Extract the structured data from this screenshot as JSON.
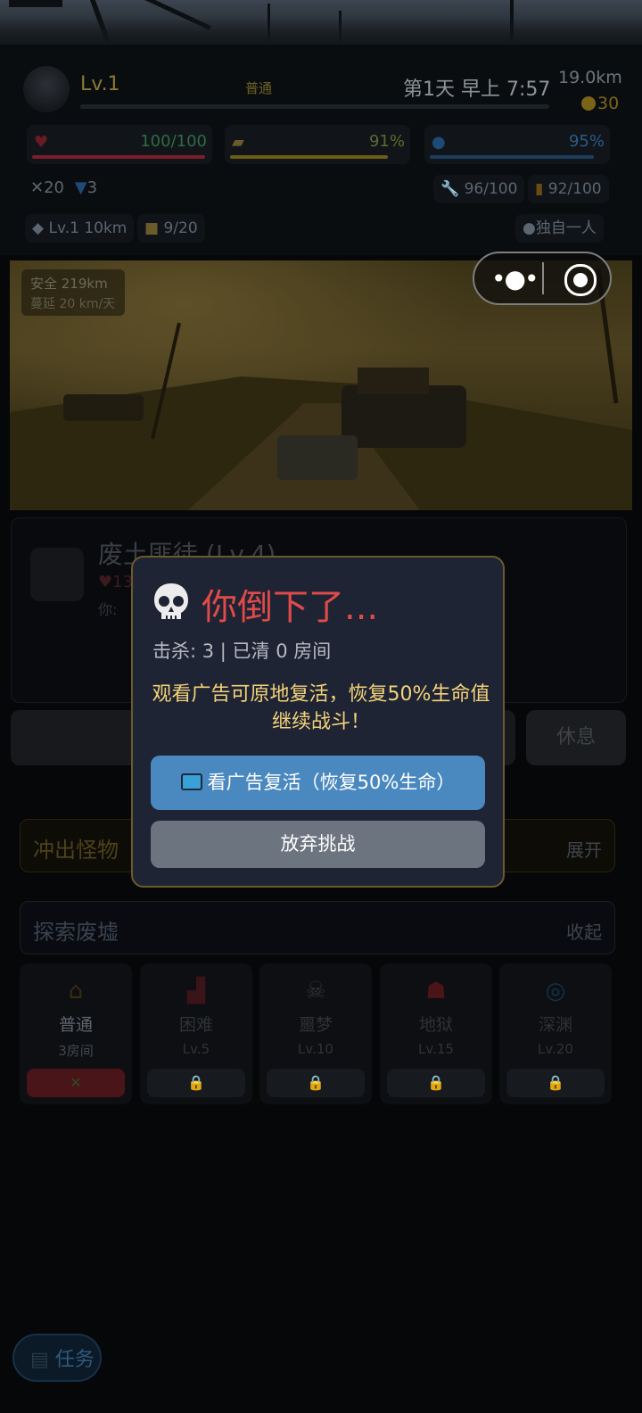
{
  "header": {
    "level": "Lv.1",
    "mode": "普通",
    "day_time": "第1天 早上 7:57",
    "distance": "19.0km",
    "coins": "30",
    "hp": "100/100",
    "food": "91%",
    "water": "95%",
    "attack": "20",
    "defense": "3",
    "tool": "96/100",
    "fuel": "92/100",
    "vehicle": "Lv.1 10km",
    "cargo": "9/20",
    "companion": "独自一人",
    "hp_fraction": 1.0,
    "food_fraction": 0.91,
    "water_fraction": 0.95
  },
  "scene": {
    "safe_distance": "安全 219km",
    "speed": "蔓延 20 km/天"
  },
  "enemy": {
    "name": "废土匪徒 (Lv.4)",
    "hp_partial": "13",
    "you_partial": "你:"
  },
  "actions": {
    "rest": "休息"
  },
  "sections": {
    "monster_title": "冲出怪物",
    "monster_toggle": "展开",
    "ruins_title": "探索废墟",
    "ruins_toggle": "收起"
  },
  "difficulties": [
    {
      "name": "普通",
      "sub": "3房间",
      "icon": "house-icon",
      "button": "✕"
    },
    {
      "name": "困难",
      "sub": "Lv.5",
      "icon": "building-icon",
      "button": "🔒"
    },
    {
      "name": "噩梦",
      "sub": "Lv.10",
      "icon": "skull-icon",
      "button": "🔒"
    },
    {
      "name": "地狱",
      "sub": "Lv.15",
      "icon": "demon-icon",
      "button": "🔒"
    },
    {
      "name": "深渊",
      "sub": "Lv.20",
      "icon": "vortex-icon",
      "button": "🔒"
    }
  ],
  "task_button": "任务",
  "modal": {
    "title": "你倒下了...",
    "kills_line": "击杀: 3 | 已清 0 房间",
    "description": "观看广告可原地复活，恢复50%生命值继续战斗！",
    "revive_button": "看广告复活（恢复50%生命）",
    "give_up_button": "放弃挑战"
  },
  "colors": {
    "modal_title": "#e04a4a",
    "modal_desc": "#f4d27a",
    "revive_button": "#4a88c0",
    "give_up_button": "#6c7480",
    "modal_border": "#6b5a2c"
  }
}
